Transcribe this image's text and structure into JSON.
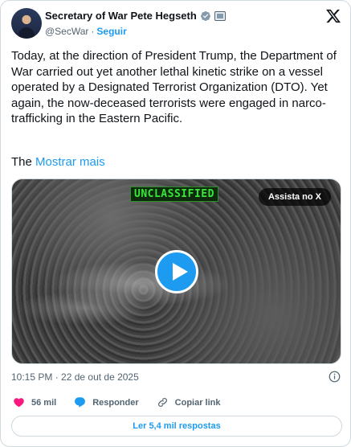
{
  "author": {
    "name": "Secretary of War Pete Hegseth",
    "handle": "@SecWar",
    "separator": "·",
    "follow_label": "Seguir"
  },
  "tweet": {
    "paragraph1": "Today, at the direction of President Trump, the Department of War carried out yet another lethal kinetic strike on a vessel operated by a Designated Terrorist Organization (DTO). Yet again, the now-deceased terrorists were engaged in narco-trafficking in the Eastern Pacific.",
    "paragraph2_start": "The",
    "show_more": "Mostrar mais"
  },
  "media": {
    "overlay_label": "UNCLASSIFIED",
    "watch_on_x": "Assista no X"
  },
  "timestamp": "10:15 PM · 22 de out de 2025",
  "actions": {
    "likes": "56 mil",
    "reply": "Responder",
    "copy_link": "Copiar link"
  },
  "read_replies": "Ler 5,4 mil respostas",
  "colors": {
    "accent": "#1d9bf0",
    "like": "#f91880",
    "text": "#0f1419",
    "secondary": "#536471"
  },
  "icons": [
    "verified-badge-icon",
    "government-badge-icon",
    "x-logo-icon",
    "play-icon",
    "info-icon",
    "heart-icon",
    "reply-icon",
    "link-icon"
  ]
}
